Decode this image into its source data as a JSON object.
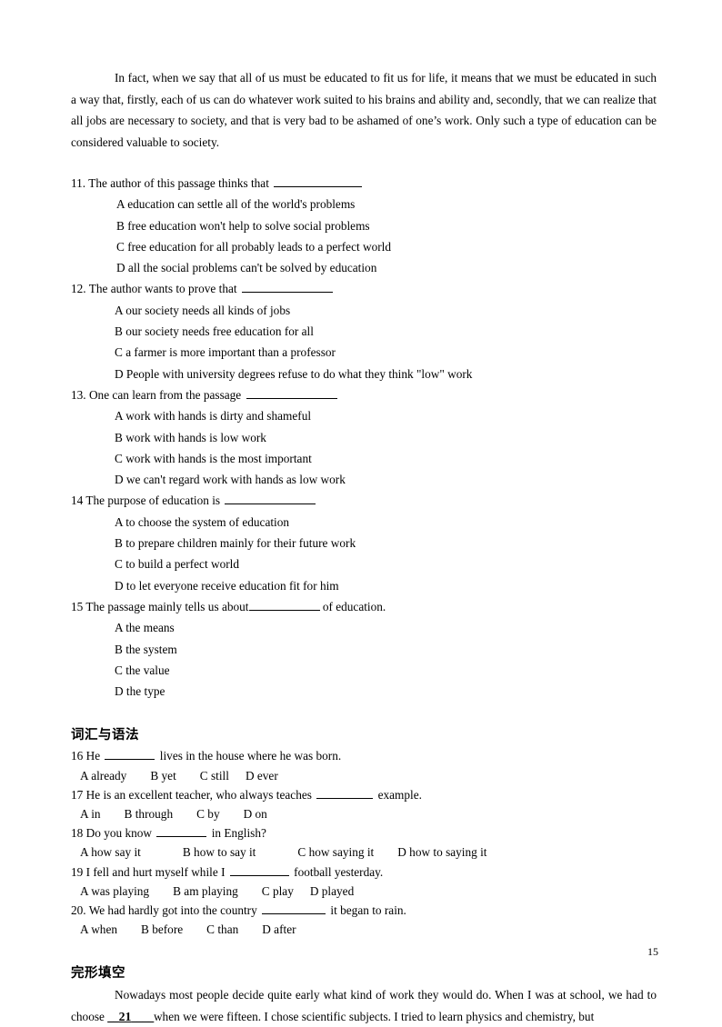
{
  "passage_top": "In fact, when we say that all of us must be educated to fit us for life, it means that we must be educated in such a way that, firstly, each of us can do whatever work suited to his brains and ability and, secondly, that we can realize that all jobs are necessary to society, and that is very bad to be ashamed of one’s work. Only such a type of education can be considered valuable to society.",
  "reading_questions": [
    {
      "number": "11.",
      "stem": "The author of this passage thinks that",
      "trailing": "",
      "options": [
        "A education can settle all of the world's problems",
        "B free education won't help to solve social problems",
        "C free education for all probably leads to a perfect world",
        "D all the social problems can't be solved by education"
      ]
    },
    {
      "number": "12.",
      "stem": "The author wants to prove that",
      "trailing": "",
      "options": [
        "A our society needs all kinds of jobs",
        "B our society needs free education for all",
        "C a farmer is more important than a professor",
        "D People with university degrees refuse to do what they think \"low\" work"
      ]
    },
    {
      "number": "13.",
      "stem": "One can learn from the passage",
      "trailing": "",
      "options": [
        "A work with hands is dirty and shameful",
        "B work with hands is low work",
        "C work with hands is the most important",
        "D we can't regard work with hands as low work"
      ]
    },
    {
      "number": "14",
      "stem": "The purpose of education is",
      "trailing": "",
      "options": [
        "A to choose the system of education",
        "B to prepare children mainly for their future work",
        "C to build a perfect world",
        "D to let everyone receive education fit for him"
      ]
    },
    {
      "number": "15",
      "stem": "The passage mainly tells us about",
      "trailing": "of education.",
      "options": [
        "A the means",
        "B the system",
        "C the value",
        "D the type"
      ]
    }
  ],
  "vocab_section": {
    "heading": "词汇与语法",
    "questions": [
      {
        "number": "16",
        "stem_before": "He",
        "stem_after": "lives in the house where he was born.",
        "options": [
          "A already",
          "B yet",
          "C still",
          "D ever"
        ]
      },
      {
        "number": "17",
        "stem_before": "He is an excellent teacher, who always teaches",
        "stem_after": "example.",
        "options": [
          "A in",
          "B through",
          "C by",
          "D on"
        ]
      },
      {
        "number": "18",
        "stem_before": "Do you know",
        "stem_after": "in English?",
        "options": [
          "A how say it",
          "B how to say it",
          "C how saying it",
          "D how to saying it"
        ]
      },
      {
        "number": "19",
        "stem_before": "I fell and hurt myself while I",
        "stem_after": "football yesterday.",
        "options": [
          "A was playing",
          "B am playing",
          "C play",
          "D played"
        ]
      },
      {
        "number": "20.",
        "stem_before": "We had hardly got into the country",
        "stem_after": "it began to rain.",
        "options": [
          "A when",
          "B before",
          "C than",
          "D after"
        ]
      }
    ]
  },
  "cloze_section": {
    "heading": "完形填空",
    "text_before": "Nowadays most people decide quite early what kind of work they would do. When I was at school, we had to choose",
    "blank_number": "21",
    "text_after": "when we were fifteen. I chose scientific subjects. I tried to learn physics and chemistry, but"
  },
  "page_number": "15"
}
